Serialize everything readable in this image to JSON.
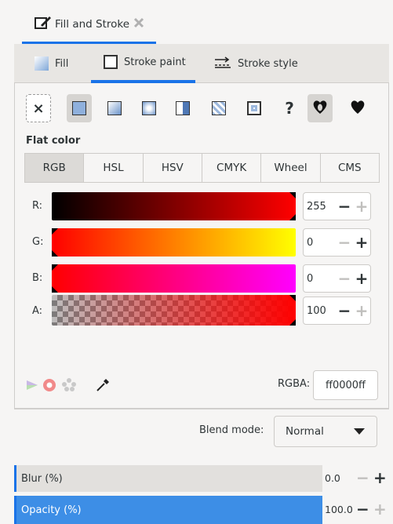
{
  "dock_tab": {
    "title": "Fill and Stroke",
    "close_icon": "close-icon"
  },
  "tabs": [
    {
      "label": "Fill",
      "icon": "fill-swatch-icon"
    },
    {
      "label": "Stroke paint",
      "icon": "stroke-swatch-icon"
    },
    {
      "label": "Stroke style",
      "icon": "stroke-style-icon"
    }
  ],
  "paint_modes": [
    "no-paint-icon",
    "flat-color-icon",
    "linear-gradient-icon",
    "radial-gradient-icon",
    "mesh-gradient-icon",
    "pattern-icon",
    "swatch-icon",
    "unset-paint-icon",
    "fill-rule-evenodd-icon",
    "fill-rule-nonzero-icon"
  ],
  "unset_glyph": "?",
  "no_paint_glyph": "×",
  "section_label": "Flat color",
  "color_modes": [
    "RGB",
    "HSL",
    "HSV",
    "CMYK",
    "Wheel",
    "CMS"
  ],
  "sliders": [
    {
      "label": "R:",
      "value": "255"
    },
    {
      "label": "G:",
      "value": "0"
    },
    {
      "label": "B:",
      "value": "0"
    },
    {
      "label": "A:",
      "value": "100"
    }
  ],
  "rgba": {
    "label": "RGBA:",
    "value": "ff0000ff"
  },
  "blend": {
    "label": "Blend mode:",
    "value": "Normal"
  },
  "blur": {
    "label": "Blur (%)",
    "value": "0.0"
  },
  "opacity": {
    "label": "Opacity (%)",
    "value": "100.0"
  },
  "colors": {
    "accent": "#1a73e8",
    "current": "#ff0000"
  }
}
